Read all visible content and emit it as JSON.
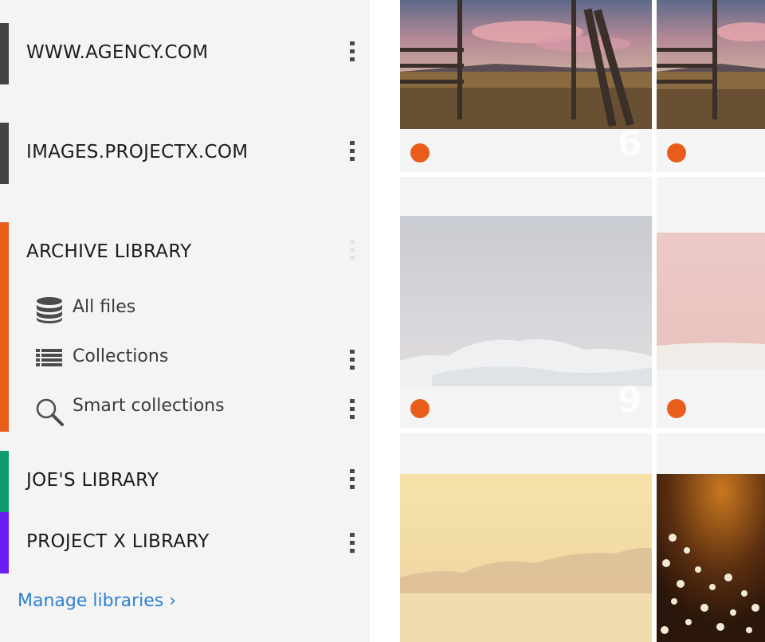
{
  "sidebar": {
    "libraries": [
      {
        "title": "WWW.AGENCY.COM",
        "color": "#444444"
      },
      {
        "title": "IMAGES.PROJECTX.COM",
        "color": "#444444"
      },
      {
        "title": "ARCHIVE LIBRARY",
        "color": "#e95d1b",
        "items": [
          {
            "label": "All files",
            "icon": "database-icon"
          },
          {
            "label": "Collections",
            "icon": "list-icon"
          },
          {
            "label": "Smart collections",
            "icon": "search-icon"
          }
        ]
      },
      {
        "title": "JOE'S LIBRARY",
        "color": "#0e9c6e"
      },
      {
        "title": "PROJECT X LIBRARY",
        "color": "#6a1ef2"
      }
    ],
    "manage_link": "Manage libraries ›"
  },
  "grid": {
    "tiles": [
      {
        "number": "6",
        "status_color": "#e95d1b",
        "photo": "fence-meadow-sunset"
      },
      {
        "number": "",
        "status_color": "#e95d1b",
        "photo": "fence-meadow-sunset"
      },
      {
        "number": "9",
        "status_color": "#e95d1b",
        "photo": "snowy-hills"
      },
      {
        "number": "",
        "status_color": "#e95d1b",
        "photo": "pink-sky-snow"
      },
      {
        "number": "",
        "photo": "misty-lake-mountains"
      },
      {
        "number": "",
        "photo": "cotton-grass-sunset"
      }
    ]
  }
}
